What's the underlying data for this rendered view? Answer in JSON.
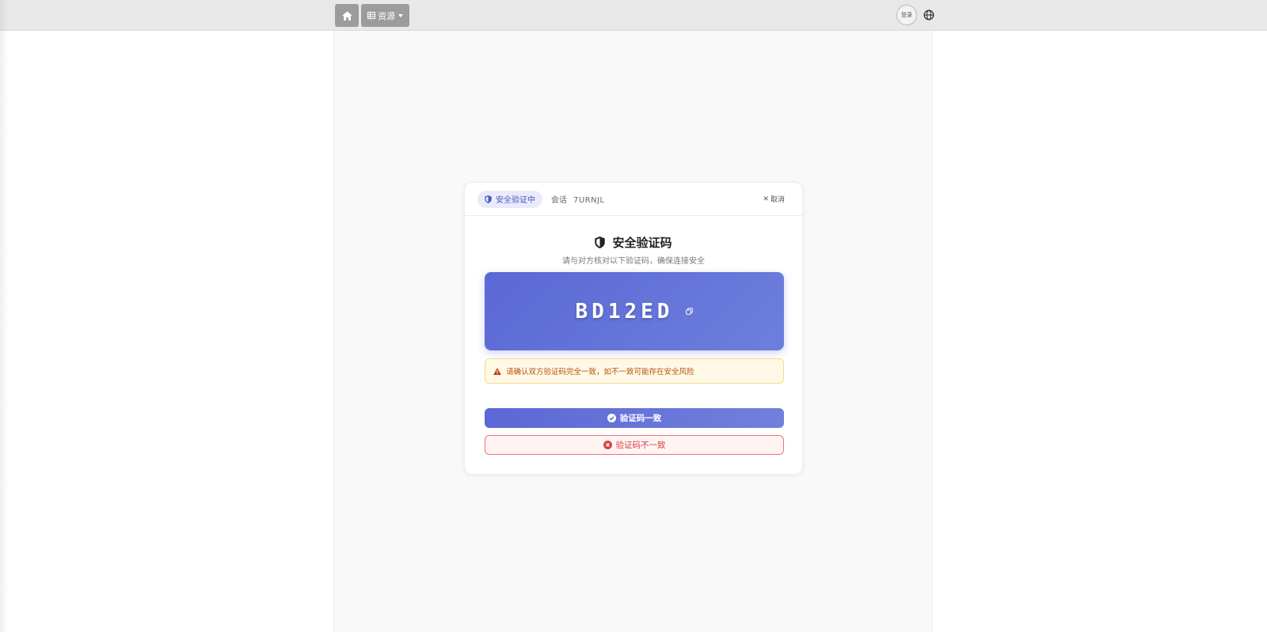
{
  "navbar": {
    "home_icon": "home-icon",
    "resources_label": "资源",
    "resources_icon": "grid-icon",
    "login_label": "登录",
    "language_icon": "globe-icon"
  },
  "card": {
    "status_label": "安全验证中",
    "session_label": "会话",
    "session_id": "7URNJL",
    "cancel_label": "取消",
    "title": "安全验证码",
    "subtitle": "请与对方核对以下验证码，确保连接安全",
    "code": "BD12ED",
    "warning": "请确认双方验证码完全一致，如不一致可能存在安全风险",
    "confirm_label": "验证码一致",
    "mismatch_label": "验证码不一致"
  },
  "colors": {
    "accent": "#5b68d6",
    "warning_text": "#b45309",
    "danger": "#d94242"
  }
}
